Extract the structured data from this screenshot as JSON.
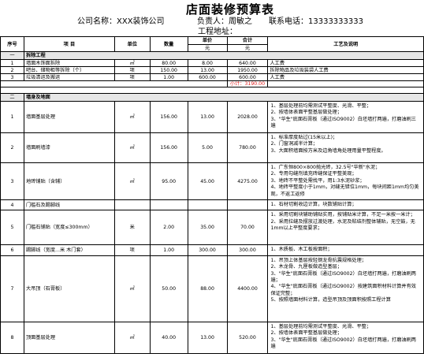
{
  "title": "店面装修预算表",
  "header": {
    "company": "公司名称：XXX装饰公司",
    "manager": "负责人：周敏之",
    "phone": "联系电话：13333333333",
    "address": "工程地址："
  },
  "columns": {
    "no": "序号",
    "item": "项      目",
    "unit": "单位",
    "qty": "数量",
    "unit_price": "单价",
    "total": "合计",
    "sub": "元",
    "sub2": "元",
    "desc": "工艺及说明"
  },
  "section1": {
    "no": "一",
    "title": "拆除工程"
  },
  "demo_rows": [
    {
      "no": "1",
      "item": "墙面木饰面拆除",
      "unit": "㎡",
      "qty": "80.00",
      "price": "8.00",
      "total": "640.00",
      "desc": "人工费"
    },
    {
      "no": "2",
      "item": "吧台、储物柜等拆除（个）",
      "unit": "项",
      "qty": "150.00",
      "price": "13.00",
      "total": "1950.00",
      "desc": "拆除物品及垃圾装袋人工费"
    },
    {
      "no": "3",
      "item": "垃圾清运及搬运",
      "unit": "项",
      "qty": "1.00",
      "price": "600.00",
      "total": "600.00",
      "desc": "人工费"
    }
  ],
  "subtotal": {
    "label": "小计：",
    "value": "3190.00"
  },
  "section2": {
    "no": "二",
    "title": "墙身及地面"
  },
  "rows": [
    {
      "no": "1",
      "item": "墙面基层处理",
      "unit": "㎡",
      "qty": "156.00",
      "price": "13.00",
      "total": "2028.00",
      "desc": "1、基层处理前均需测试平整度、光滑、平整；\n2、按墙体表面平整基层做处理；\n3、\"华生\"底面石膏板（通过ISO9002）白坯墙打两遍，打磨油刷三遍"
    },
    {
      "no": "2",
      "item": "墙面刷墙漆",
      "unit": "㎡",
      "qty": "156.00",
      "price": "5.00",
      "total": "780.00",
      "desc": "1、标准厚度贴过(15米以上)；\n2、门窗洞减半计算；\n3、大面积墙面按方米及边角墙角处理用量平整程度。"
    },
    {
      "no": "3",
      "item": "地砖铺贴（含辅）",
      "unit": "㎡",
      "qty": "95.00",
      "price": "45.00",
      "total": "4275.00",
      "desc": "1、广东恒800×800抛光砖，32.5号\"华新\"水泥；\n2、专用勾缝剂填充砖缝保证平整美观；\n3、地砖不平整处需找平，用1:3水泥砂浆；\n4、地砖平整度小于1mm，对缝无错位1mm，每块间距1mm均匀美观，不返工返修"
    },
    {
      "no": "4",
      "item": "门槛石及踢脚线",
      "unit": "",
      "qty": "",
      "price": "",
      "total": "",
      "desc": "1、石材切割收边计算，块数铺贴计算；"
    },
    {
      "no": "5",
      "item": "门槛石铺贴（宽度≤300mm）",
      "unit": "米",
      "qty": "2.00",
      "price": "35.00",
      "total": "70.00",
      "desc": "1、采用切割块辅助铺贴实用，按铺贴米计算，不足一米按一米计；\n2、采用拉缝及摆放过渡处理，水泥及粘结剂整体辅贴，无空鼓，无1mm以上平整度要求；"
    },
    {
      "no": "6",
      "item": "踢脚线（宽度...米 木门套）",
      "unit": "项",
      "qty": "1.00",
      "price": "300.00",
      "total": "300.00",
      "desc": "1、木质板、木工板按面积；"
    },
    {
      "no": "7",
      "item": "大吊顶（石膏板）",
      "unit": "㎡",
      "qty": "50.00",
      "price": "88.00",
      "total": "4400.00",
      "desc": "1、吊顶上体基层按轻钢龙骨抗震规格处理；\n2、木龙骨、九厘板做造型基层；\n3、\"华生\"底面石膏板（通过ISO9002）白坯墙打两遍，打磨油刷两遍；\n4、\"华生\"底面石膏板（通过ISO9002）按建筑面积材料计算并有效保证完整；\n5、按照墙面材料计算，造型吊顶及顶面积按照工程计算"
    },
    {
      "no": "8",
      "item": "顶面基层处理",
      "unit": "㎡",
      "qty": "40.00",
      "price": "13.00",
      "total": "520.00",
      "desc": "1、基层处理前均需测试平整度、光滑、平整；\n2、按墙体表面平整基层做处理；\n3、\"华生\"底面石膏板（通过ISO9002）白坯墙打两遍，打磨油刷两遍"
    }
  ]
}
